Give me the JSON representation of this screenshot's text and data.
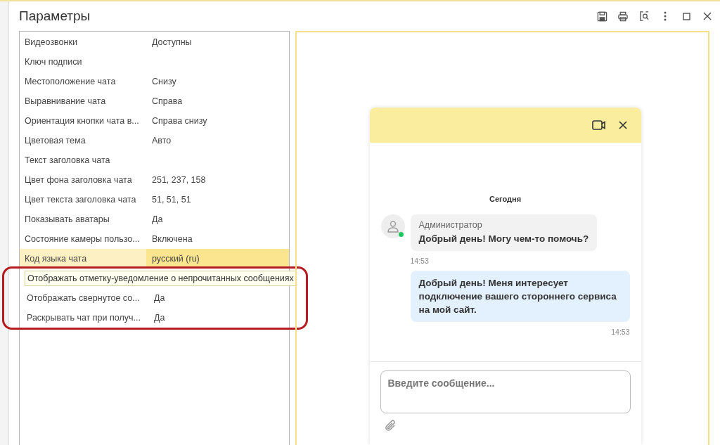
{
  "window": {
    "title": "Параметры"
  },
  "properties": [
    {
      "label": "Видеозвонки",
      "value": "Доступны",
      "selected": false,
      "kind": "row",
      "in_callout": false
    },
    {
      "label": "Ключ подписи",
      "selected": false,
      "kind": "row",
      "in_callout": false
    },
    {
      "label": "Местоположение чата",
      "value": "Снизу",
      "selected": false,
      "kind": "row",
      "in_callout": false
    },
    {
      "label": "Выравнивание чата",
      "value": "Справа",
      "selected": false,
      "kind": "row",
      "in_callout": false
    },
    {
      "label": "Ориентация кнопки чата в...",
      "value": "Справа снизу",
      "selected": false,
      "kind": "row",
      "in_callout": false
    },
    {
      "label": "Цветовая тема",
      "value": "Авто",
      "selected": false,
      "kind": "row",
      "in_callout": false
    },
    {
      "label": "Текст заголовка чата",
      "selected": false,
      "kind": "row",
      "in_callout": false
    },
    {
      "label": "Цвет фона заголовка чата",
      "value": "251, 237, 158",
      "selected": false,
      "kind": "row",
      "in_callout": false
    },
    {
      "label": "Цвет текста заголовка чата",
      "value": "51, 51, 51",
      "selected": false,
      "kind": "row",
      "in_callout": false
    },
    {
      "label": "Показывать аватары",
      "value": "Да",
      "selected": false,
      "kind": "row",
      "in_callout": false
    },
    {
      "label": "Состояние камеры пользо...",
      "value": "Включена",
      "selected": false,
      "kind": "row",
      "in_callout": false
    },
    {
      "label": "Код языка чата",
      "value": "русский (ru)",
      "selected": true,
      "kind": "row",
      "in_callout": false
    },
    {
      "label": "Отображать отметку-уведомление о непрочитанных сообщениях",
      "kind": "tooltip",
      "in_callout": true
    },
    {
      "label": "Отображать свернутое со...",
      "value": "Да",
      "selected": false,
      "kind": "row",
      "in_callout": true
    },
    {
      "label": "Раскрывать чат при получ...",
      "value": "Да",
      "selected": false,
      "kind": "row",
      "in_callout": true
    }
  ],
  "chat": {
    "date": "Сегодня",
    "messages": [
      {
        "kind": "incoming",
        "author": "Администратор",
        "text": "Добрый день! Могу чем-то помочь?",
        "time": "14:53",
        "online": true
      },
      {
        "kind": "outgoing",
        "text": "Добрый день! Меня интересует подключение вашего стороннего сервиса на мой сайт.",
        "time": "14:53"
      }
    ],
    "input": {
      "placeholder": "Введите сообщение..."
    }
  }
}
